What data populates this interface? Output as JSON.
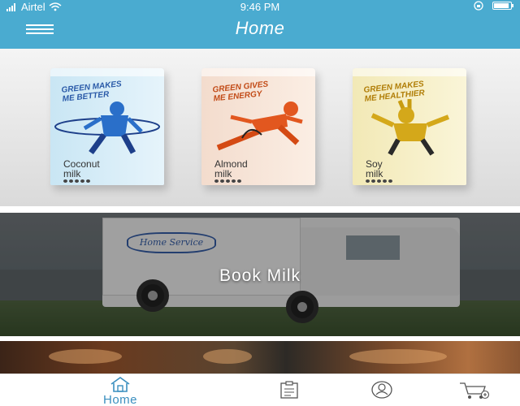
{
  "status_bar": {
    "carrier": "Airtel",
    "time": "9:46 PM",
    "icons": [
      "signal-icon",
      "wifi-icon",
      "lock-rotation-icon",
      "battery-icon"
    ]
  },
  "header": {
    "title": "Home",
    "menu_icon": "hamburger-menu-icon",
    "background_color": "#4aabd0"
  },
  "carousel": {
    "slides_count": 6,
    "active_index": 4,
    "active_dot_color": "#2c56b6",
    "cartons": [
      {
        "tagline_1": "GREEN MAKES",
        "tagline_2": "ME BETTER",
        "name_1": "Coconut",
        "name_2": "milk",
        "color": "#c9e6f4"
      },
      {
        "tagline_1": "GREEN GIVES",
        "tagline_2": "ME ENERGY",
        "name_1": "Almond",
        "name_2": "milk",
        "color": "#f3dccd"
      },
      {
        "tagline_1": "GREEN MAKES",
        "tagline_2": "ME HEALTHIER",
        "name_1": "Soy",
        "name_2": "milk",
        "color": "#f2e9b6"
      }
    ]
  },
  "banner": {
    "label": "Book Milk",
    "truck_brand": "Home Service"
  },
  "tabbar": {
    "accent_color": "#3a8fbf",
    "tabs": [
      {
        "label": "Home",
        "icon": "home-icon",
        "active": true
      },
      {
        "label": "",
        "icon": "clipboard-icon",
        "active": false
      },
      {
        "label": "",
        "icon": "user-profile-icon",
        "active": false
      },
      {
        "label": "",
        "icon": "cart-add-icon",
        "active": false
      }
    ]
  }
}
